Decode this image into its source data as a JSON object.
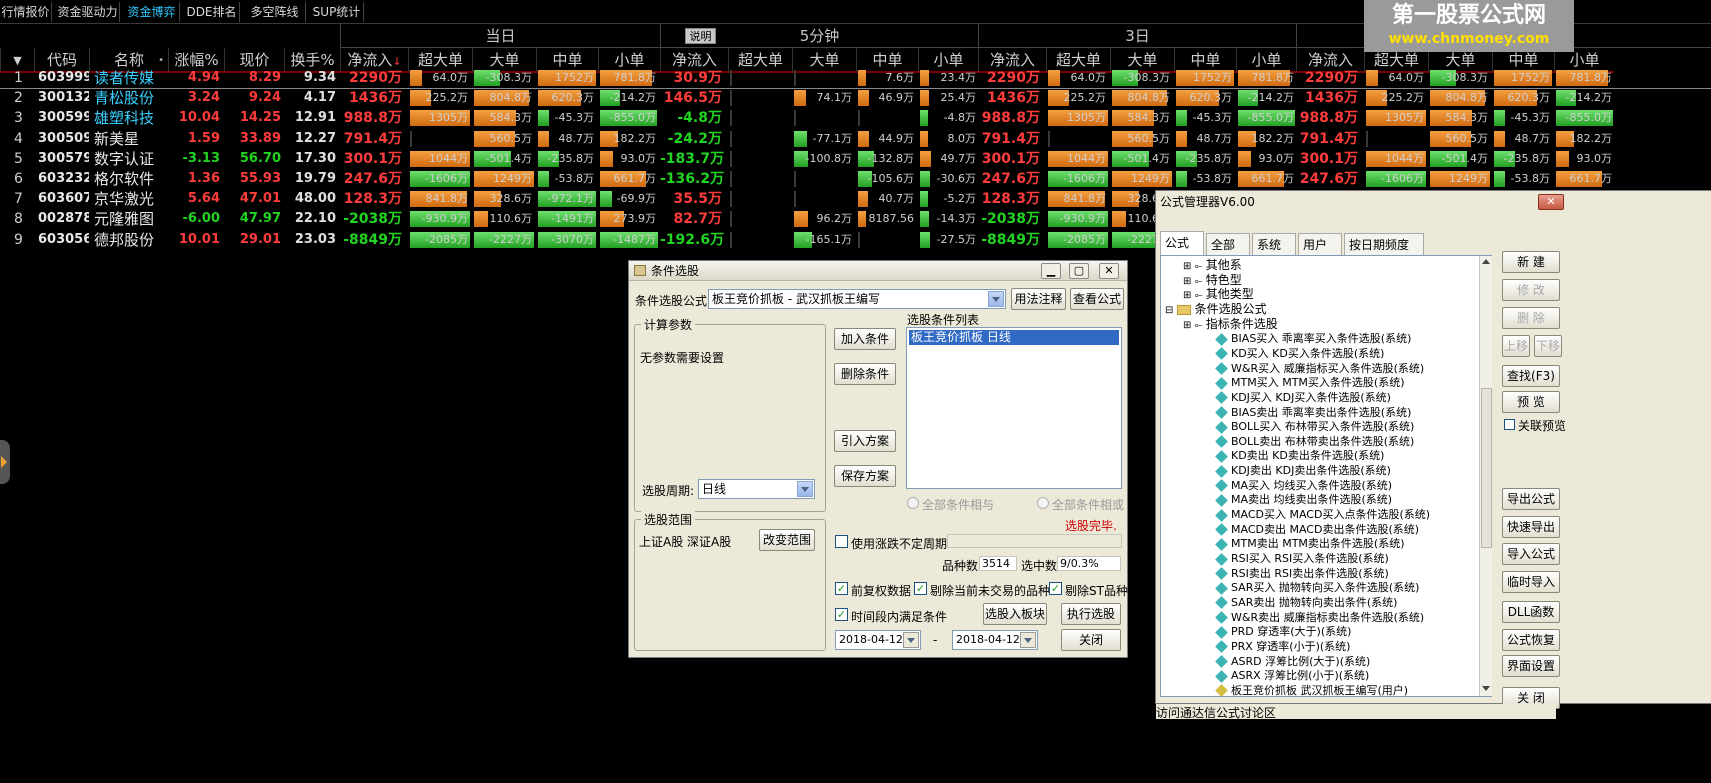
{
  "topbar": {
    "tabs": [
      "行情报价",
      "资金驱动力",
      "资金博弈",
      "DDE排名",
      "多空阵线",
      "SUP统计"
    ],
    "active": 2
  },
  "groups": {
    "today": "当日",
    "min5": "5分钟",
    "day3": "3日",
    "help": "说明"
  },
  "columns": {
    "code": "代码",
    "name": "名称",
    "chg": "涨幅%",
    "price": "现价",
    "turnover": "换手%",
    "net": "净流入",
    "super": "超大单",
    "big": "大单",
    "mid": "中单",
    "small": "小单",
    "sort_mark": "↓"
  },
  "logo": {
    "line1": "第一股票公式网",
    "line2": "www.chnmoney.com"
  },
  "rows": [
    {
      "idx": "1",
      "code": "603999",
      "name": "读者传媒",
      "cyan": true,
      "chg": "4.94",
      "price": "8.29",
      "turnover": "9.34",
      "net": "2290万",
      "super": "64.0万",
      "big": "-308.3万",
      "mid": "1752万",
      "small": "781.8万",
      "m5net": "30.9万",
      "m5mid": "7.6万",
      "m5small": "23.4万"
    },
    {
      "idx": "2",
      "code": "300132",
      "name": "青松股份",
      "cyan": true,
      "chg": "3.24",
      "price": "9.24",
      "turnover": "4.17",
      "net": "1436万",
      "super": "225.2万",
      "big": "804.8万",
      "mid": "620.3万",
      "small": "-214.2万",
      "m5net": "146.5万",
      "m5big": "74.1万",
      "m5mid": "46.9万",
      "m5small": "25.4万"
    },
    {
      "idx": "3",
      "code": "300599",
      "name": "雄塑科技",
      "cyan": true,
      "chg": "10.04",
      "price": "14.25",
      "turnover": "12.91",
      "net": "988.8万",
      "super": "1305万",
      "big": "584.3万",
      "mid": "-45.3万",
      "small": "-855.0万",
      "m5net": "-4.8万",
      "m5small": "-4.8万"
    },
    {
      "idx": "4",
      "code": "300509",
      "name": "新美星",
      "cyan": false,
      "chg": "1.59",
      "price": "33.89",
      "turnover": "12.27",
      "net": "791.4万",
      "super": "",
      "big": "560.5万",
      "mid": "48.7万",
      "small": "182.2万",
      "m5net": "-24.2万",
      "m5big": "-77.1万",
      "m5mid": "44.9万",
      "m5small": "8.0万"
    },
    {
      "idx": "5",
      "code": "300579",
      "name": "数字认证",
      "cyan": false,
      "chg": "-3.13",
      "price": "56.70",
      "turnover": "17.30",
      "net": "300.1万",
      "super": "1044万",
      "big": "-501.4万",
      "mid": "-235.8万",
      "small": "93.0万",
      "m5net": "-183.7万",
      "m5big": "-100.8万",
      "m5mid": "-132.8万",
      "m5small": "49.7万"
    },
    {
      "idx": "6",
      "code": "603232",
      "name": "格尔软件",
      "cyan": false,
      "chg": "1.36",
      "price": "55.93",
      "turnover": "19.79",
      "net": "247.6万",
      "super": "-1606万",
      "big": "1249万",
      "mid": "-53.8万",
      "small": "661.7万",
      "m5net": "-136.2万",
      "m5mid": "-105.6万",
      "m5small": "-30.6万"
    },
    {
      "idx": "7",
      "code": "603607",
      "name": "京华激光",
      "cyan": false,
      "chg": "5.64",
      "price": "47.01",
      "turnover": "48.00",
      "net": "128.3万",
      "super": "841.8万",
      "big": "328.6万",
      "mid": "-972.1万",
      "small": "-69.9万",
      "m5net": "35.5万",
      "m5mid": "40.7万",
      "m5small": "-5.2万"
    },
    {
      "idx": "8",
      "code": "002878",
      "name": "元隆雅图",
      "cyan": false,
      "chg": "-6.00",
      "price": "47.97",
      "turnover": "22.10",
      "net": "-2038万",
      "super": "-930.9万",
      "big": "110.6万",
      "mid": "-1491万",
      "small": "273.9万",
      "m5net": "82.7万",
      "m5big": "96.2万",
      "m5mid": "8187.56",
      "m5small": "-14.3万"
    },
    {
      "idx": "9",
      "code": "603056",
      "name": "德邦股份",
      "cyan": false,
      "chg": "10.01",
      "price": "29.01",
      "turnover": "23.03",
      "net": "-8849万",
      "super": "-2085万",
      "big": "-2227万",
      "mid": "-3070万",
      "small": "-1487万",
      "m5net": "-192.6万",
      "m5big": "-165.1万",
      "m5small": "-27.5万"
    }
  ],
  "cond_dialog": {
    "title": "条件选股",
    "formula_label": "条件选股公式",
    "formula_value": "板王竞价抓板 - 武汉抓板王编写",
    "btn_usage": "用法注释",
    "btn_view": "查看公式",
    "calc_params": "计算参数",
    "no_params": "无参数需要设置",
    "period_label": "选股周期:",
    "period_value": "日线",
    "btn_add": "加入条件",
    "btn_delete": "删除条件",
    "btn_import": "引入方案",
    "btn_save": "保存方案",
    "list_label": "选股条件列表",
    "list_item": "板王竞价抓板  日线",
    "radio_and": "全部条件相与",
    "radio_or": "全部条件相或",
    "done": "选股完毕.",
    "scope_label": "选股范围",
    "scope_value": "上证A股 深证A股",
    "btn_scope": "改变范围",
    "chk_variable": "使用涨跌不定周期",
    "count_label": "品种数",
    "count_value": "3514",
    "selected_label": "选中数",
    "selected_value": "9/0.3%",
    "chk_adjust": "前复权数据",
    "chk_exclude_untraded": "剔除当前未交易的品种",
    "chk_exclude_st": "剔除ST品种",
    "chk_time": "时间段内满足条件",
    "btn_to_block": "选股入板块",
    "btn_execute": "执行选股",
    "date_from": "2018-04-12",
    "date_sep": "-",
    "date_to": "2018-04-12",
    "btn_close": "关闭"
  },
  "formula_manager": {
    "title": "公式管理器V6.00",
    "tabs": [
      "公式组",
      "全部",
      "系统",
      "用户",
      "按日期频度"
    ],
    "tree": [
      {
        "text": "其他系",
        "level": 1,
        "type": "node"
      },
      {
        "text": "特色型",
        "level": 1,
        "type": "node"
      },
      {
        "text": "其他类型",
        "level": 1,
        "type": "node"
      },
      {
        "text": "条件选股公式",
        "level": 0,
        "type": "folder"
      },
      {
        "text": "指标条件选股",
        "level": 1,
        "type": "node"
      },
      {
        "text": "BIAS买入  乖离率买入条件选股(系统)",
        "level": 2,
        "type": "leaf"
      },
      {
        "text": "KD买入   KD买入条件选股(系统)",
        "level": 2,
        "type": "leaf"
      },
      {
        "text": "W&R买入  威廉指标买入条件选股(系统)",
        "level": 2,
        "type": "leaf"
      },
      {
        "text": "MTM买入  MTM买入条件选股(系统)",
        "level": 2,
        "type": "leaf"
      },
      {
        "text": "KDJ买入  KDJ买入条件选股(系统)",
        "level": 2,
        "type": "leaf"
      },
      {
        "text": "BIAS卖出  乖离率卖出条件选股(系统)",
        "level": 2,
        "type": "leaf"
      },
      {
        "text": "BOLL买入  布林带买入条件选股(系统)",
        "level": 2,
        "type": "leaf"
      },
      {
        "text": "BOLL卖出  布林带卖出条件选股(系统)",
        "level": 2,
        "type": "leaf"
      },
      {
        "text": "KD卖出   KD卖出条件选股(系统)",
        "level": 2,
        "type": "leaf"
      },
      {
        "text": "KDJ卖出  KDJ卖出条件选股(系统)",
        "level": 2,
        "type": "leaf"
      },
      {
        "text": "MA买入   均线买入条件选股(系统)",
        "level": 2,
        "type": "leaf"
      },
      {
        "text": "MA卖出   均线卖出条件选股(系统)",
        "level": 2,
        "type": "leaf"
      },
      {
        "text": "MACD买入  MACD买入点条件选股(系统)",
        "level": 2,
        "type": "leaf"
      },
      {
        "text": "MACD卖出  MACD卖出条件选股(系统)",
        "level": 2,
        "type": "leaf"
      },
      {
        "text": "MTM卖出  MTM卖出条件选股(系统)",
        "level": 2,
        "type": "leaf"
      },
      {
        "text": "RSI买入  RSI买入条件选股(系统)",
        "level": 2,
        "type": "leaf"
      },
      {
        "text": "RSI卖出  RSI卖出条件选股(系统)",
        "level": 2,
        "type": "leaf"
      },
      {
        "text": "SAR买入  抛物转向买入条件选股(系统)",
        "level": 2,
        "type": "leaf"
      },
      {
        "text": "SAR卖出  抛物转向卖出条件(系统)",
        "level": 2,
        "type": "leaf"
      },
      {
        "text": "W&R卖出  威廉指标卖出条件选股(系统)",
        "level": 2,
        "type": "leaf"
      },
      {
        "text": "PRD  穿透率(大于)(系统)",
        "level": 2,
        "type": "leaf"
      },
      {
        "text": "PRX  穿透率(小于)(系统)",
        "level": 2,
        "type": "leaf"
      },
      {
        "text": "ASRD  浮筹比例(大于)(系统)",
        "level": 2,
        "type": "leaf"
      },
      {
        "text": "ASRX  浮筹比例(小于)(系统)",
        "level": 2,
        "type": "leaf"
      },
      {
        "text": "板王竞价抓板  武汉抓板王编写(用户)",
        "level": 2,
        "type": "leaf-user"
      }
    ],
    "buttons": [
      {
        "label": "新 建",
        "disabled": false
      },
      {
        "label": "修 改",
        "disabled": true
      },
      {
        "label": "删 除",
        "disabled": true
      },
      {
        "label": "上移",
        "disabled": true
      },
      {
        "label": "下移",
        "disabled": true
      },
      {
        "label": "查找(F3)",
        "disabled": false
      },
      {
        "label": "预 览",
        "disabled": false
      },
      {
        "label": "关联预览",
        "disabled": false
      },
      {
        "label": "导出公式",
        "disabled": false
      },
      {
        "label": "快速导出",
        "disabled": false
      },
      {
        "label": "导入公式",
        "disabled": false
      },
      {
        "label": "临时导入",
        "disabled": false
      },
      {
        "label": "DLL函数",
        "disabled": false
      },
      {
        "label": "公式恢复",
        "disabled": false
      },
      {
        "label": "界面设置",
        "disabled": false
      },
      {
        "label": "关 闭",
        "disabled": false
      }
    ],
    "status": "访问通达信公式讨论区"
  },
  "colors": {
    "up": "#ff3c3c",
    "down": "#22d422",
    "accent": "#2fc8ff",
    "buy_bar": "#f0902a",
    "sell_bar": "#44c844"
  }
}
